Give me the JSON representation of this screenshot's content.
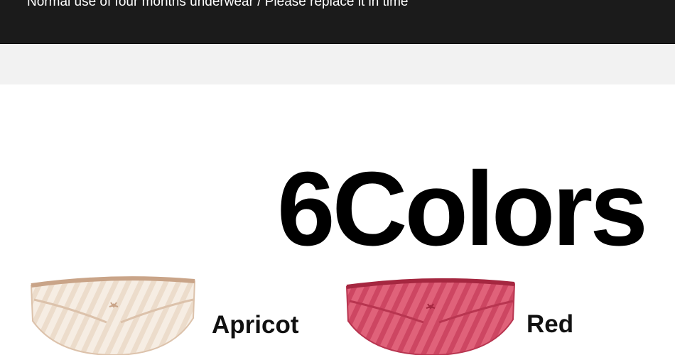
{
  "banner": {
    "text": "Normal use of four months underwear / Please replace it in time"
  },
  "headline": {
    "text": "6Colors"
  },
  "products": [
    {
      "label": "Apricot",
      "color": "#f3e7da",
      "trim": "#d9b89f"
    },
    {
      "label": "Red",
      "color": "#d8506a",
      "trim": "#b02a44"
    }
  ]
}
